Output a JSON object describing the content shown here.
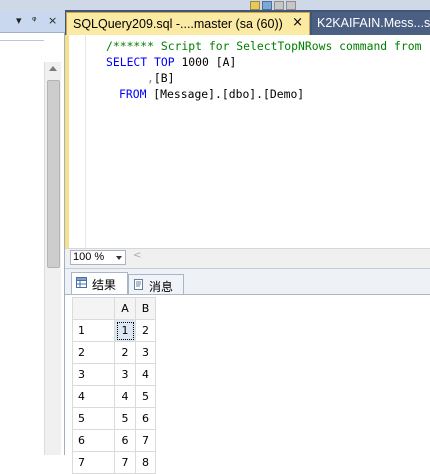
{
  "left_panel": {
    "controls": [
      "▾",
      "ᵠ",
      "×"
    ]
  },
  "tabs": {
    "active": {
      "label": "SQLQuery209.sql -....master (sa (60))",
      "close": "×"
    },
    "inactive": {
      "label": "K2KAIFAIN.Mess...s"
    }
  },
  "editor": {
    "line1": "/****** Script for SelectTopNRows command from",
    "line2_kw1": "SELECT",
    "line2_kw2": "TOP",
    "line2_rest": " 1000 [A]",
    "line3_comma": ",",
    "line3_rest": "[B]",
    "line4_kw": "FROM",
    "line4_rest": " [Message].[dbo].[Demo]"
  },
  "zoom": {
    "value": "100 %",
    "scroll_left": "<"
  },
  "results": {
    "tabs": [
      {
        "label": "结果",
        "icon": "grid-icon"
      },
      {
        "label": "消息",
        "icon": "message-icon"
      }
    ],
    "columns": [
      "A",
      "B"
    ],
    "rows": [
      {
        "n": "1",
        "a": "1",
        "b": "2"
      },
      {
        "n": "2",
        "a": "2",
        "b": "3"
      },
      {
        "n": "3",
        "a": "3",
        "b": "4"
      },
      {
        "n": "4",
        "a": "4",
        "b": "5"
      },
      {
        "n": "5",
        "a": "5",
        "b": "6"
      },
      {
        "n": "6",
        "a": "6",
        "b": "7"
      },
      {
        "n": "7",
        "a": "7",
        "b": "8"
      }
    ]
  },
  "colors": {
    "active_tab": "#fbeaa3",
    "tab_bar": "#3f5476",
    "keyword": "#0000ff",
    "comment": "#008000"
  }
}
